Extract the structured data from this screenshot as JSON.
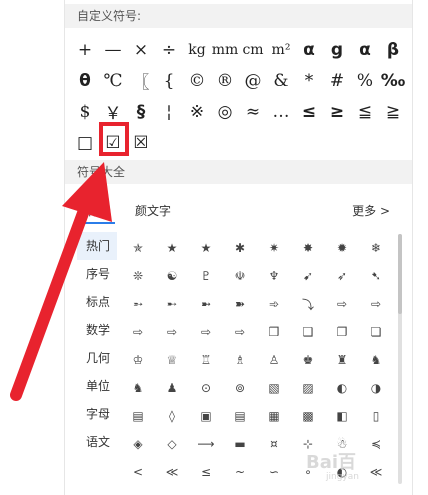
{
  "custom_section": {
    "title": "自定义符号:"
  },
  "custom_symbols": [
    "+",
    "—",
    "×",
    "÷",
    "kg",
    "mm",
    "cm",
    "m²",
    "α",
    "g",
    "α",
    "β",
    "θ",
    "℃",
    "〖",
    "{",
    "©",
    "®",
    "@",
    "&",
    "*",
    "#",
    "%",
    "‰",
    "$",
    "￥",
    "§",
    "¦",
    "※",
    "◎",
    "≈",
    "…",
    "≤",
    "≥",
    "≦",
    "≧",
    "□",
    "☑",
    "☒"
  ],
  "selected_symbol": "☑",
  "all_section": {
    "title": "符号大全"
  },
  "tabs": {
    "symbol": "符号",
    "kaomoji": "颜文字",
    "more": "更多 >"
  },
  "categories": [
    "热门",
    "序号",
    "标点",
    "数学",
    "几何",
    "单位",
    "字母",
    "语文"
  ],
  "symbol_grid": [
    "✯",
    "★",
    "★",
    "✱",
    "✷",
    "✸",
    "✹",
    "❄",
    "❊",
    "☯",
    "♇",
    "☫",
    "♆",
    "➹",
    "➶",
    "➷",
    "➵",
    "➸",
    "➼",
    "➽",
    "➾",
    "⤵",
    "⇨",
    "⇨",
    "⇨",
    "⇨",
    "⇨",
    "⇨",
    "❒",
    "❑",
    "❐",
    "❏",
    "♔",
    "♕",
    "♖",
    "♗",
    "♙",
    "♚",
    "♜",
    "♞",
    "♞",
    "♟",
    "⊙",
    "⊚",
    "▧",
    "▨",
    "◐",
    "◑",
    "▤",
    "◊",
    "▣",
    "▤",
    "▦",
    "▩",
    "◧",
    "▯",
    "◈",
    "◇",
    "⟶",
    "▬",
    "¤",
    "⊹",
    "☃",
    "≼",
    "<",
    "≪",
    "≤",
    "~",
    "∽",
    "∘",
    "◐",
    "≪"
  ],
  "watermark": {
    "text": "Bai百",
    "sub": "jingyan"
  },
  "colors": {
    "highlight": "#e8232e",
    "arrow": "#e8232e",
    "accent": "#2b7de9"
  }
}
